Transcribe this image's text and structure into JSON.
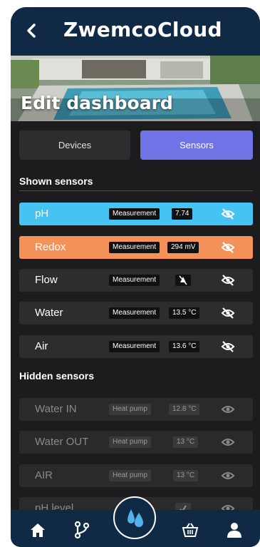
{
  "header": {
    "back_icon": "chevron-left-icon",
    "brand": "ZwemcoCloud"
  },
  "hero": {
    "title": "Edit dashboard"
  },
  "tabs": [
    {
      "label": "Devices",
      "active": false
    },
    {
      "label": "Sensors",
      "active": true
    }
  ],
  "shown": {
    "title": "Shown sensors",
    "items": [
      {
        "name": "pH",
        "tag": "Measurement",
        "value": "7.74",
        "color": "#45c4f4"
      },
      {
        "name": "Redox",
        "tag": "Measurement",
        "value": "294 mV",
        "color": "#f4925a"
      },
      {
        "name": "Flow",
        "tag": "Measurement",
        "value_icon": "no-flow-icon"
      },
      {
        "name": "Water",
        "tag": "Measurement",
        "value": "13.5 °C"
      },
      {
        "name": "Air",
        "tag": "Measurement",
        "value": "13.6 °C"
      }
    ]
  },
  "hidden": {
    "title": "Hidden sensors",
    "items": [
      {
        "name": "Water IN",
        "tag": "Heat pump",
        "value": "12.8 °C"
      },
      {
        "name": "Water OUT",
        "tag": "Heat pump",
        "value": "13 °C"
      },
      {
        "name": "AIR",
        "tag": "Heat pump",
        "value": "13 °C"
      },
      {
        "name": "pH level",
        "tag": "",
        "value_icon": "check-icon"
      }
    ]
  },
  "bottom_nav": [
    "home-icon",
    "flow-icon",
    "water-drop-icon",
    "basket-icon",
    "user-icon"
  ],
  "colors": {
    "header": "#102a45",
    "tab_active": "#6f73e6",
    "ph": "#45c4f4",
    "redox": "#f4925a"
  }
}
